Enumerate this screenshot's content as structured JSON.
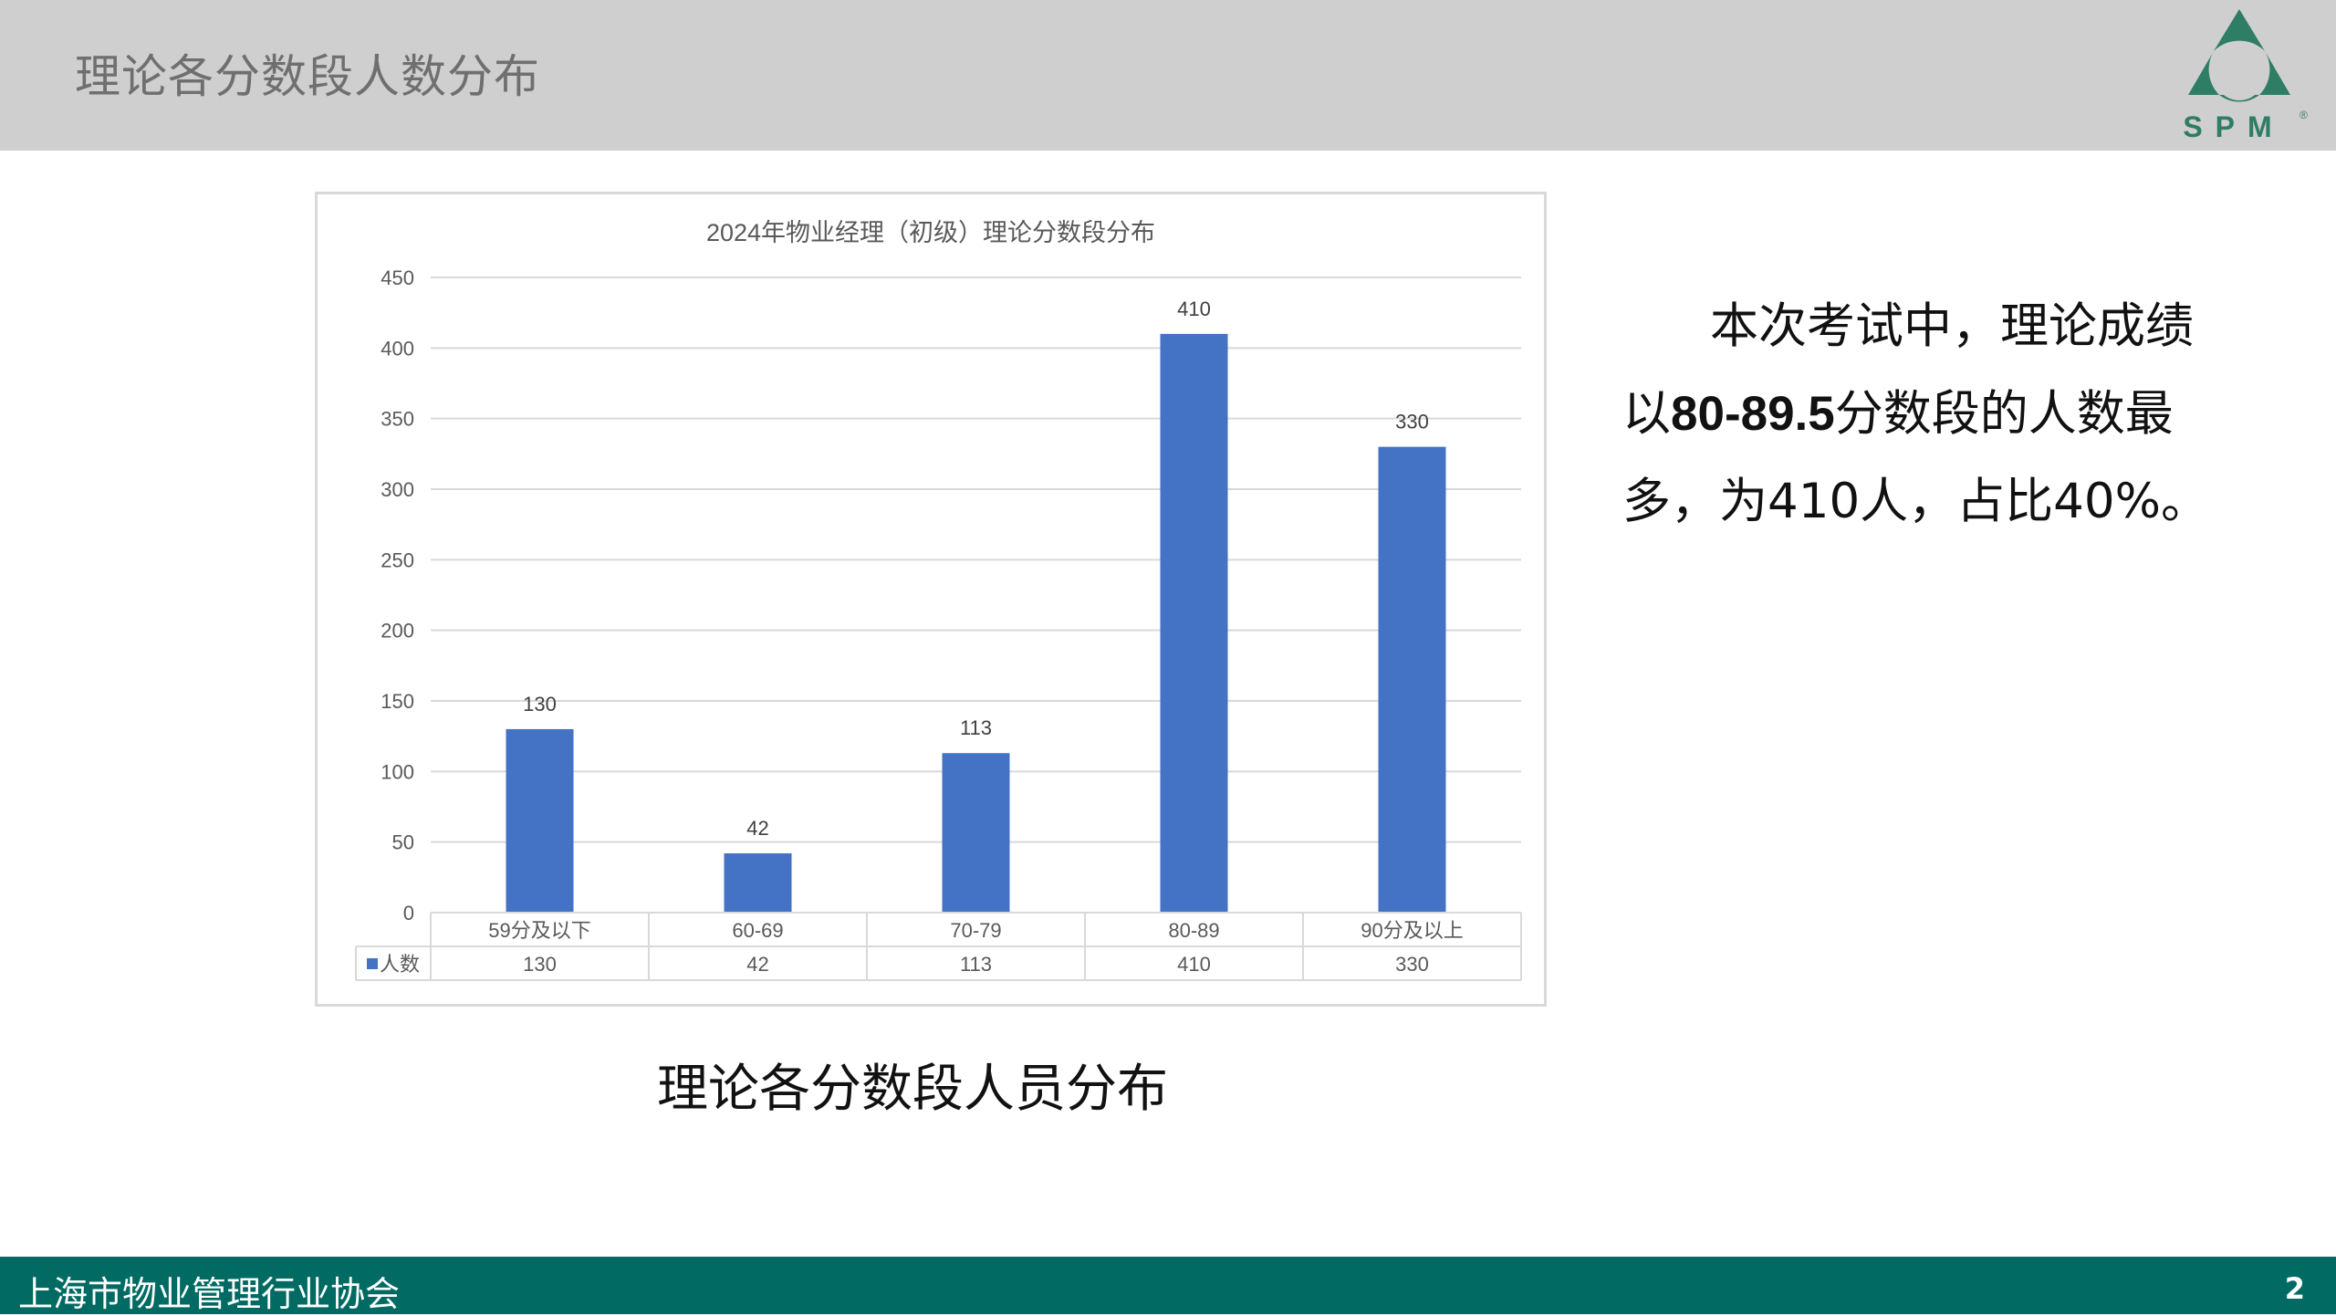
{
  "header": {
    "title": "理论各分数段人数分布"
  },
  "logo": {
    "text": "SPM",
    "mark": "®",
    "color": "#2e7d64"
  },
  "chart_data": {
    "type": "bar",
    "title": "2024年物业经理（初级）理论分数段分布",
    "categories": [
      "59分及以下",
      "60-69",
      "70-79",
      "80-89",
      "90分及以上"
    ],
    "series": [
      {
        "name": "人数",
        "values": [
          130,
          42,
          113,
          410,
          330
        ],
        "color": "#4472c4"
      }
    ],
    "ylim": [
      0,
      450
    ],
    "yticks": [
      0,
      50,
      100,
      150,
      200,
      250,
      300,
      350,
      400,
      450
    ],
    "grid": true,
    "data_table": true,
    "data_labels": true
  },
  "caption": "理论各分数段人员分布",
  "note": {
    "line1": "本次考试中，理论成绩",
    "line2_pre": "以",
    "line2_bold": "80-89.5",
    "line2_post": "分数段的人数最",
    "line3": "多，为410人，占比40%。"
  },
  "footer": {
    "org": "上海市物业管理行业协会",
    "page": "2"
  }
}
